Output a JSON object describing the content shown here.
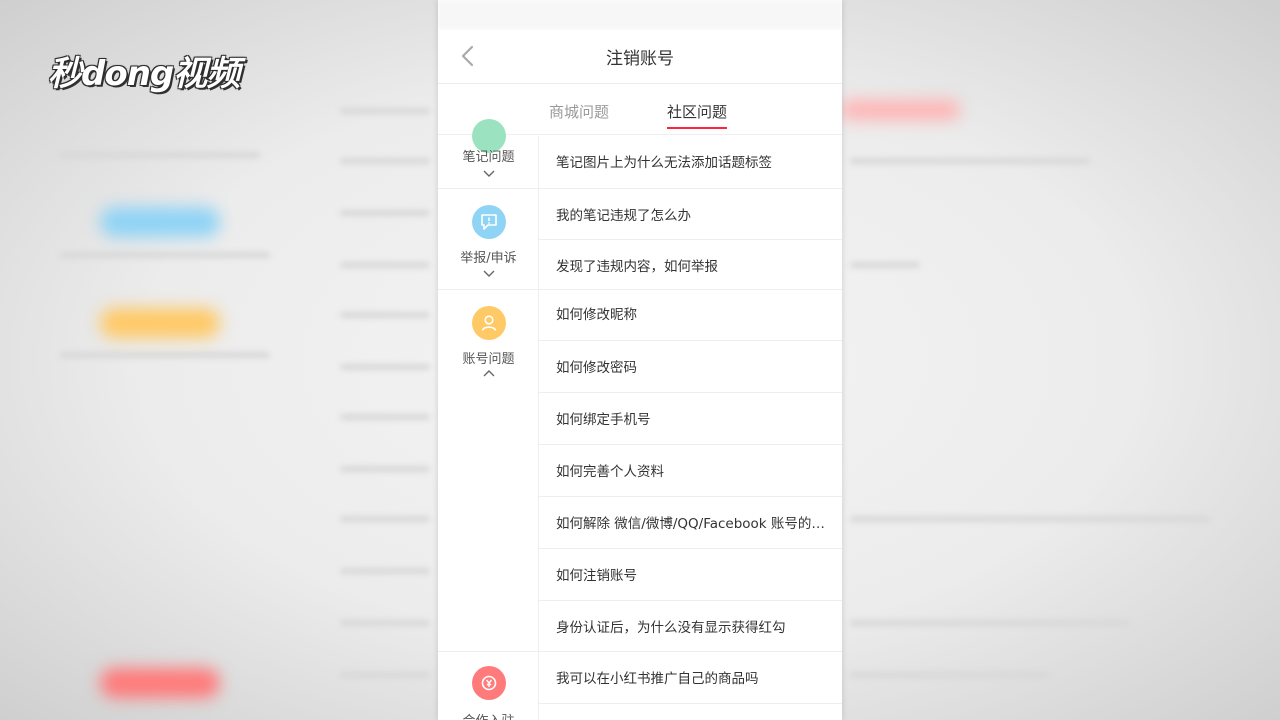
{
  "watermark": {
    "logo_text": "秒dong视频"
  },
  "navbar": {
    "title": "注销账号"
  },
  "tabs": [
    {
      "label": "商城问题",
      "active": false
    },
    {
      "label": "社区问题",
      "active": true
    }
  ],
  "accent_color": "#ff2442",
  "categories": [
    {
      "label": "笔记问题",
      "icon": "note-icon",
      "color": "#9be2c0",
      "expanded": false
    },
    {
      "label": "举报/申诉",
      "icon": "chat-alert-icon",
      "color": "#8fd3f5",
      "expanded": false
    },
    {
      "label": "账号问题",
      "icon": "user-icon",
      "color": "#ffc966",
      "expanded": true
    },
    {
      "label": "合作入驻",
      "icon": "coin-icon",
      "color": "#ff7a7a",
      "expanded": false
    }
  ],
  "questions": [
    "笔记图片上为什么无法添加话题标签",
    "我的笔记违规了怎么办",
    "发现了违规内容，如何举报",
    "如何修改昵称",
    "如何修改密码",
    "如何绑定手机号",
    "如何完善个人资料",
    "如何解除 微信/微博/QQ/Facebook 账号的绑定",
    "如何注销账号",
    "身份认证后，为什么没有显示获得红勾",
    "我可以在小红书推广自己的商品吗"
  ]
}
